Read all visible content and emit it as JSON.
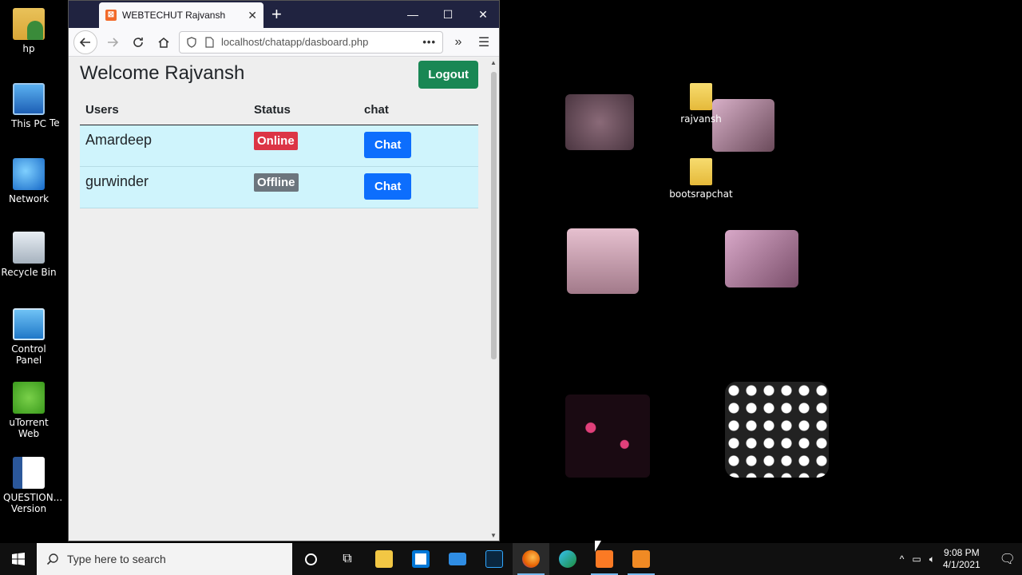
{
  "desktop": {
    "icons": [
      {
        "label": "hp",
        "icon": "user-folder-icon"
      },
      {
        "label": "This PC",
        "icon": "computer-icon"
      },
      {
        "label": "Network",
        "icon": "network-icon"
      },
      {
        "label": "Recycle Bin",
        "icon": "recycle-bin-icon"
      },
      {
        "label": "Control Panel",
        "icon": "control-panel-icon"
      },
      {
        "label": "uTorrent Web",
        "icon": "utorrent-icon"
      },
      {
        "label": "QUESTION... Version",
        "icon": "word-doc-icon"
      }
    ],
    "folders": [
      {
        "label": "rajvansh",
        "icon": "folder-icon"
      },
      {
        "label": "bootsrapchat",
        "icon": "folder-icon"
      }
    ],
    "partial_labels": [
      "Te"
    ]
  },
  "browser": {
    "tab_title": "WEBTECHUT Rajvansh",
    "url": "localhost/chatapp/dasboard.php",
    "controls": {
      "minimize": "—",
      "maximize": "☐",
      "close": "✕",
      "new_tab": "+"
    }
  },
  "page": {
    "welcome": "Welcome Rajvansh",
    "logout_label": "Logout",
    "table": {
      "headers": [
        "Users",
        "Status",
        "chat"
      ],
      "rows": [
        {
          "user": "Amardeep",
          "status": "Online",
          "status_color": "#dc3545",
          "action": "Chat"
        },
        {
          "user": "gurwinder",
          "status": "Offline",
          "status_color": "#6c757d",
          "action": "Chat"
        }
      ]
    }
  },
  "taskbar": {
    "search_placeholder": "Type here to search",
    "time": "9:08 PM",
    "date": "4/1/2021",
    "apps": [
      "cortana-icon",
      "task-view-icon",
      "file-explorer-icon",
      "store-icon",
      "mail-icon",
      "photoshop-icon",
      "firefox-icon",
      "edge-icon",
      "xampp-icon",
      "app-icon"
    ]
  },
  "colors": {
    "logout": "#198754",
    "chat_button": "#0d6efd",
    "row_bg": "#cff4fc",
    "titlebar": "#202340"
  }
}
